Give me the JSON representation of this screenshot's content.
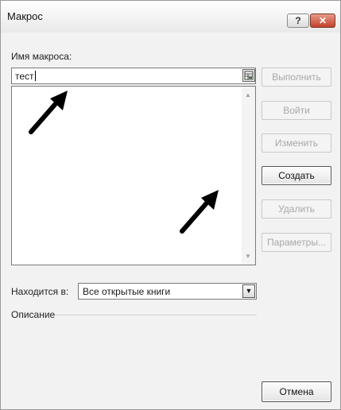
{
  "dialog": {
    "title": "Макрос",
    "help_label": "?",
    "close_label": "✕"
  },
  "macro": {
    "name_label": "Имя макроса:",
    "name_value": "тест"
  },
  "buttons": {
    "run": "Выполнить",
    "step_into": "Войти",
    "edit": "Изменить",
    "create": "Создать",
    "delete": "Удалить",
    "options": "Параметры...",
    "cancel": "Отмена"
  },
  "location": {
    "label": "Находится в:",
    "value": "Все открытые книги"
  },
  "description": {
    "label": "Описание",
    "value": ""
  },
  "icons": {
    "ref": "collapse-dialog-icon",
    "scroll_up": "scroll-up-icon",
    "scroll_down": "scroll-down-icon",
    "dropdown": "chevron-down-icon"
  },
  "colors": {
    "close_button": "#c2402b",
    "disabled_text": "#a8a8a8"
  }
}
